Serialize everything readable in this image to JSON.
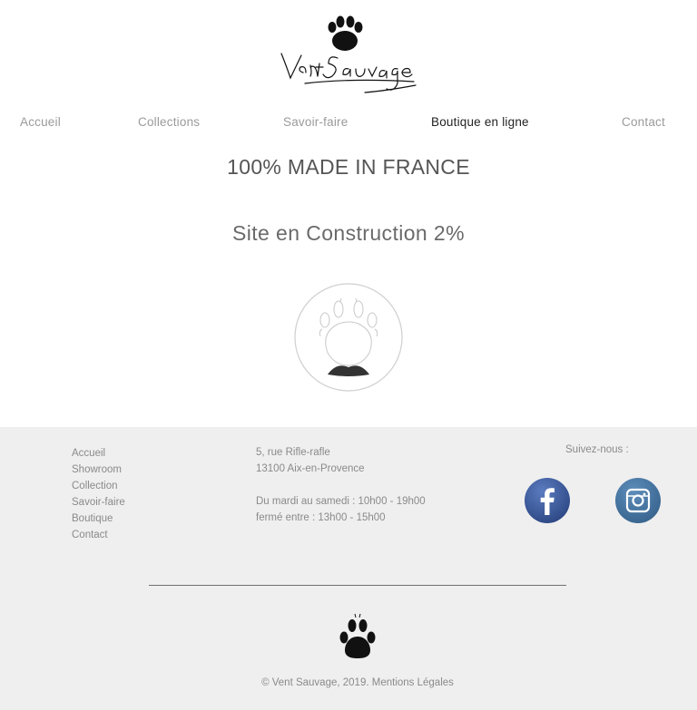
{
  "brand": {
    "name": "Vent Sauvage"
  },
  "nav": {
    "items": [
      {
        "label": "Accueil",
        "active": false
      },
      {
        "label": "Collections",
        "active": false
      },
      {
        "label": "Savoir-faire",
        "active": false
      },
      {
        "label": "Boutique en ligne",
        "active": true
      },
      {
        "label": "Contact",
        "active": false
      }
    ]
  },
  "main": {
    "tagline": "100% MADE IN FRANCE",
    "construction": "Site en Construction 2%"
  },
  "footer": {
    "links": [
      "Accueil",
      "Showroom",
      "Collection",
      "Savoir-faire",
      "Boutique",
      "Contact"
    ],
    "address": {
      "street": "5, rue Rifle-rafle",
      "city": "13100 Aix-en-Provence",
      "hours_1": "Du mardi au samedi : 10h00 - 19h00",
      "hours_2": "fermé entre : 13h00 - 15h00"
    },
    "follow_label": "Suivez-nous :",
    "social": [
      {
        "name": "facebook-icon",
        "color": "#3b5998"
      },
      {
        "name": "instagram-icon",
        "color": "#3f729b"
      }
    ],
    "copyright": "© Vent Sauvage, 2019.",
    "legal_link": "Mentions Légales"
  },
  "colors": {
    "footer_bg": "#efefef",
    "nav_inactive": "#9a9a9a",
    "nav_active": "#222222"
  }
}
